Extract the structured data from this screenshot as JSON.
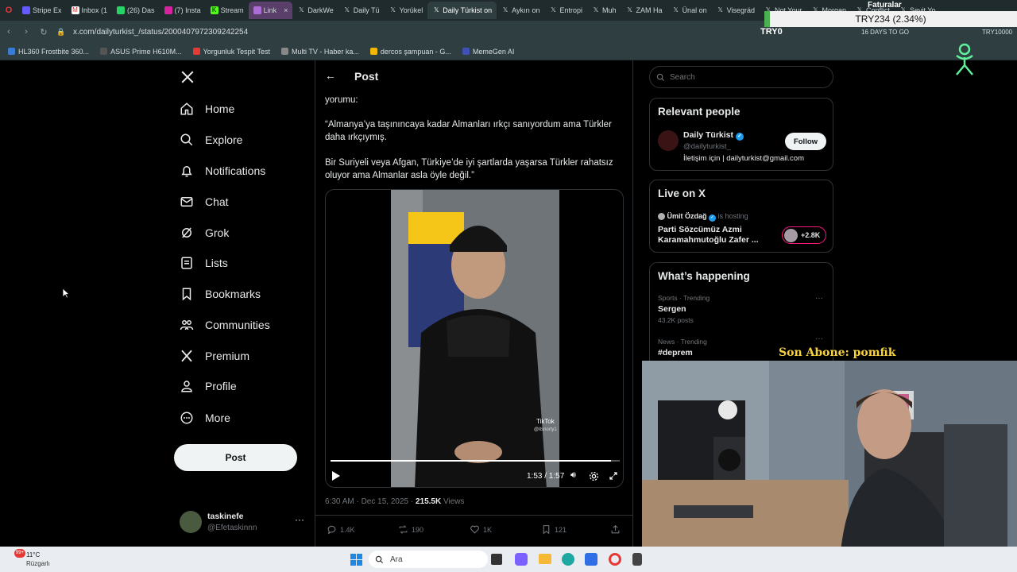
{
  "browser": {
    "tabs": [
      {
        "label": "Stripe Ex",
        "icon": "stripe-icon"
      },
      {
        "label": "Inbox (1",
        "icon": "gmail-icon"
      },
      {
        "label": "(26) Das",
        "icon": "chat-icon"
      },
      {
        "label": "(7) Insta",
        "icon": "instagram-icon"
      },
      {
        "label": "Stream",
        "icon": "kick-icon"
      },
      {
        "label": "Link",
        "icon": "link-icon"
      },
      {
        "label": "DarkWe",
        "icon": "x-icon"
      },
      {
        "label": "Daily Tü",
        "icon": "x-icon"
      },
      {
        "label": "Yorükel",
        "icon": "x-icon"
      },
      {
        "label": "Daily Türkist on",
        "icon": "x-icon"
      },
      {
        "label": "Aykırı on",
        "icon": "x-icon"
      },
      {
        "label": "Entropi",
        "icon": "x-icon"
      },
      {
        "label": "Muh",
        "icon": "x-icon"
      },
      {
        "label": "ZAM Ha",
        "icon": "x-icon"
      },
      {
        "label": "Ünal on",
        "icon": "x-icon"
      },
      {
        "label": "Visegrád",
        "icon": "x-icon"
      },
      {
        "label": "Not Your",
        "icon": "x-icon"
      },
      {
        "label": "Morgan",
        "icon": "x-icon"
      },
      {
        "label": "Conflict",
        "icon": "x-icon"
      },
      {
        "label": "Sevit Yo",
        "icon": "x-icon"
      }
    ],
    "url": "x.com/dailyturkist_/status/2000407972309242254",
    "bookmarks": [
      {
        "label": "HL360 Frostbite 360...",
        "color": "#3a7bd5"
      },
      {
        "label": "ASUS Prime H610M...",
        "color": "#222222"
      },
      {
        "label": "Yorgunluk Tespit Test",
        "color": "#e53935"
      },
      {
        "label": "Multi TV - Haber ka...",
        "color": "#888888"
      },
      {
        "label": "dercos şampuan - G...",
        "color": "#f2b705"
      },
      {
        "label": "MemeGen AI",
        "color": "#3f51b5"
      }
    ]
  },
  "overlay": {
    "title": "Faturalar",
    "value": "TRY234 (2.34%)",
    "ticker": "TRY0",
    "days": "16 DAYS TO GO",
    "goal": "TRY10000"
  },
  "nav": {
    "items": [
      "Home",
      "Explore",
      "Notifications",
      "Chat",
      "Grok",
      "Lists",
      "Bookmarks",
      "Communities",
      "Premium",
      "Profile",
      "More"
    ],
    "post_button": "Post",
    "account": {
      "name": "taskinefe",
      "handle": "@Efetaskinnn"
    }
  },
  "post": {
    "header": "Post",
    "text_top": "yorumu:",
    "quote1": "“Almanya’ya taşınıncaya kadar Almanları ırkçı sanıyordum ama Türkler daha ırkçıymış.",
    "quote2": "Bir Suriyeli veya Afgan, Türkiye’de iyi şartlarda yaşarsa Türkler rahatsız oluyor ama Almanlar asla öyle değil.”",
    "video_time": "1:53 / 1:57",
    "video_progress": 0.97,
    "tiktok_label": "TikTok",
    "tiktok_handle": "@itsnorty1",
    "timestamp": "6:30 AM · Dec 15, 2025 ·",
    "views_count": "215.5K",
    "views_label": "Views",
    "replies": "1.4K",
    "reposts": "190",
    "likes": "1K",
    "bookmarks": "121"
  },
  "sidebar": {
    "search_placeholder": "Search",
    "relevant_title": "Relevant people",
    "person": {
      "name": "Daily Türkist",
      "handle": "@dailyturkist_",
      "bio": "İletişim için | dailyturkist@gmail.com",
      "follow": "Follow"
    },
    "live_title": "Live on X",
    "live": {
      "host": "Ümit Özdağ",
      "hosting": "is hosting",
      "title": "Parti Sözcümüz Azmi Karamahmutoğlu Zafer ...",
      "count": "+2.8K"
    },
    "happening_title": "What’s happening",
    "trends": [
      {
        "meta": "Sports · Trending",
        "name": "Sergen",
        "posts": "43.2K posts"
      },
      {
        "meta": "News · Trending",
        "name": "#deprem",
        "posts": ""
      }
    ]
  },
  "stream": {
    "last_sub": "Son Abone: pomfik"
  },
  "taskbar": {
    "temp": "11°C",
    "weather": "Rüzgarlı",
    "search": "Ara",
    "badge": "99+"
  },
  "colors": {
    "accent": "#1d9bf0",
    "verified": "#1d9bf0",
    "live_pink": "#f91880",
    "sub_yellow": "#f7d23e",
    "progress": "#ffffff"
  }
}
